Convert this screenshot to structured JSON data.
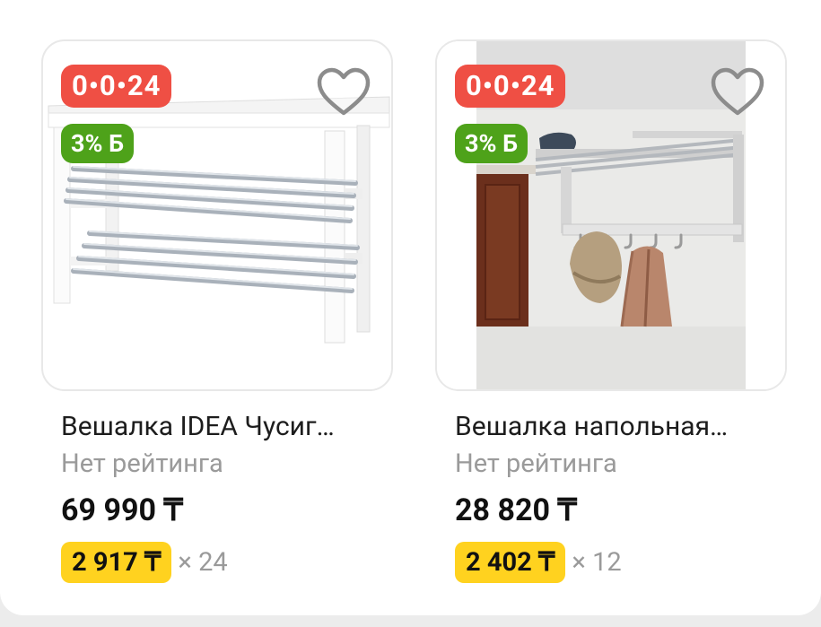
{
  "products": [
    {
      "timer": "0•0•24",
      "bonus": "3% Б",
      "title": "Вешалка IDEA Чусиг…",
      "rating": "Нет рейтинга",
      "price": "69 990 ₸",
      "installment_price": "2 917 ₸",
      "installment_months": "× 24",
      "image": "white-shoe-bench"
    },
    {
      "timer": "0•0•24",
      "bonus": "3% Б",
      "title": "Вешалка напольная…",
      "rating": "Нет рейтинга",
      "price": "28 820 ₸",
      "installment_price": "2 402 ₸",
      "installment_months": "× 12",
      "image": "wall-hat-rack-with-hooks"
    }
  ],
  "colors": {
    "timer_badge": "#ef4f44",
    "bonus_badge": "#4ea21a",
    "installment_pill": "#ffd21f",
    "muted_text": "#9a9a9a"
  }
}
